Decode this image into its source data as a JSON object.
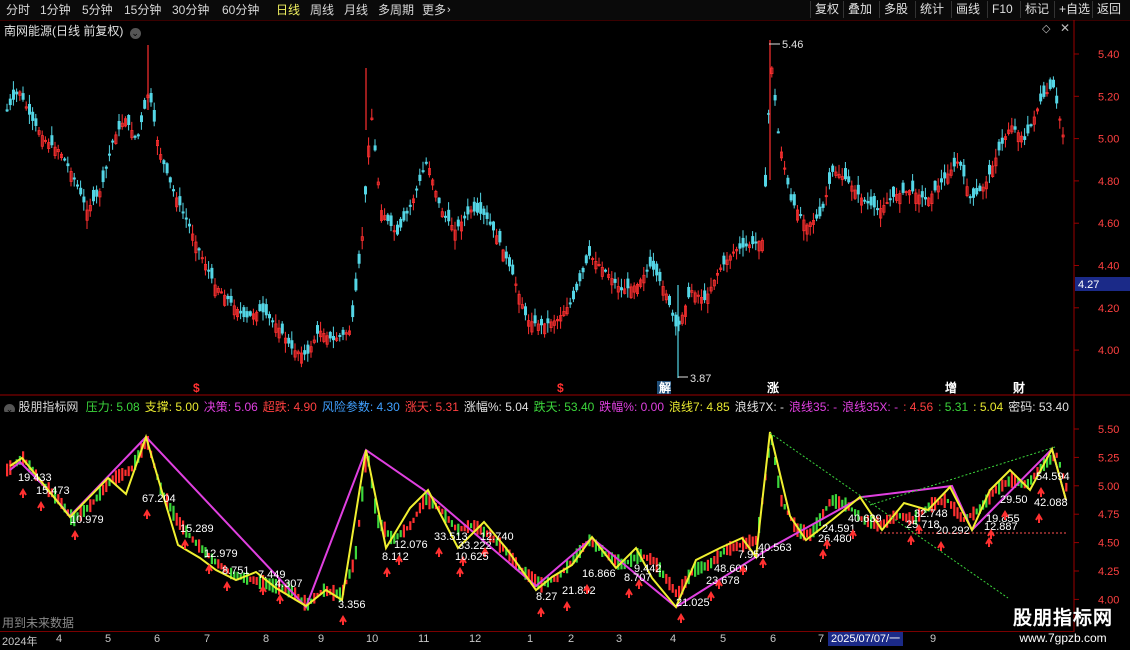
{
  "toolbar": {
    "periods": [
      "分时",
      "1分钟",
      "5分钟",
      "15分钟",
      "30分钟",
      "60分钟",
      "日线",
      "周线",
      "月线",
      "多周期",
      "更多"
    ],
    "active_period": "日线",
    "more_arrow": "chevron-right-icon",
    "right_buttons": [
      "复权",
      "叠加",
      "多股",
      "统计",
      "画线",
      "F10",
      "标记",
      "+自选",
      "返回"
    ]
  },
  "main_panel": {
    "title": "南网能源(日线 前复权)",
    "high_label": "5.46",
    "low_label": "3.87",
    "current_price": "4.27",
    "price_axis": [
      "5.40",
      "5.20",
      "5.00",
      "4.80",
      "4.60",
      "4.40",
      "4.20",
      "4.00"
    ],
    "event_markers": [
      {
        "text": "$",
        "color": "#ff3030"
      },
      {
        "text": "$",
        "color": "#ff3030"
      },
      {
        "text": "解",
        "color": "#ffffff",
        "bg": "#1f4e79"
      },
      {
        "text": "涨",
        "color": "#ffffff"
      },
      {
        "text": "增",
        "color": "#ffffff"
      },
      {
        "text": "财",
        "color": "#ffffff"
      }
    ],
    "colors": {
      "up": "#ff3030",
      "down": "#54d6e6",
      "price_tag_bg": "#1b2a88"
    }
  },
  "indicator_panel": {
    "name": "股朋指标网",
    "params": [
      {
        "label": "压力:",
        "value": "5.08",
        "color": "#3cd63c"
      },
      {
        "label": "支撑:",
        "value": "5.00",
        "color": "#e8e830"
      },
      {
        "label": "决策:",
        "value": "5.06",
        "color": "#e040e0"
      },
      {
        "label": "超跌:",
        "value": "4.90",
        "color": "#ff4040"
      },
      {
        "label": "风险参数:",
        "value": "4.30",
        "color": "#40a0ff"
      },
      {
        "label": "涨天:",
        "value": "5.31",
        "color": "#ff4040"
      },
      {
        "label": "涨幅%:",
        "value": "5.04",
        "color": "#e0e0e0"
      },
      {
        "label": "跌天:",
        "value": "53.40",
        "color": "#3cd63c"
      },
      {
        "label": "跌幅%:",
        "value": "0.00",
        "color": "#e040e0"
      },
      {
        "label": "浪线7:",
        "value": "4.85",
        "color": "#e8e830"
      },
      {
        "label": "浪线7X:",
        "value": "-",
        "color": "#e0e0e0"
      },
      {
        "label": "浪线35:",
        "value": "-",
        "color": "#e040e0"
      },
      {
        "label": "浪线35X:",
        "value": "-",
        "color": "#e040e0"
      },
      {
        "label": ":",
        "value": "4.56",
        "color": "#ff4040"
      },
      {
        "label": ":",
        "value": "5.31",
        "color": "#3cd63c"
      },
      {
        "label": ":",
        "value": "5.04",
        "color": "#e8e830"
      },
      {
        "label": "密码:",
        "value": "53.40",
        "color": "#e0e0e0"
      }
    ],
    "axis": [
      "5.50",
      "5.25",
      "5.00",
      "4.75",
      "4.50",
      "4.25",
      "4.00"
    ],
    "wave_labels": [
      "19.433",
      "15.473",
      "10.979",
      "67.204",
      "15.289",
      "12.979",
      "8.751",
      "7.449",
      "4.307",
      "3.356",
      "8.112",
      "12.076",
      "33.513",
      "33.222",
      "12.740",
      "10.625",
      "8.27",
      "21.852",
      "16.866",
      "8.707",
      "9.442",
      "21.025",
      "23.678",
      "48.609",
      "7.951",
      "40.563",
      "26.480",
      "24.591",
      "40.639",
      "25.718",
      "32.748",
      "20.292",
      "12.887",
      "19.855",
      "29.50",
      "42.088",
      "54.594"
    ]
  },
  "date_axis": {
    "labels": [
      "2024年",
      "4",
      "5",
      "6",
      "7",
      "8",
      "9",
      "10",
      "11",
      "12",
      "1",
      "2",
      "3",
      "4",
      "5",
      "6",
      "7",
      "9"
    ],
    "cursor_date": "2025/07/07/一"
  },
  "footer": {
    "note": "用到未来数据"
  },
  "watermark": {
    "title": "股朋指标网",
    "url": "www.7gpzb.com"
  }
}
